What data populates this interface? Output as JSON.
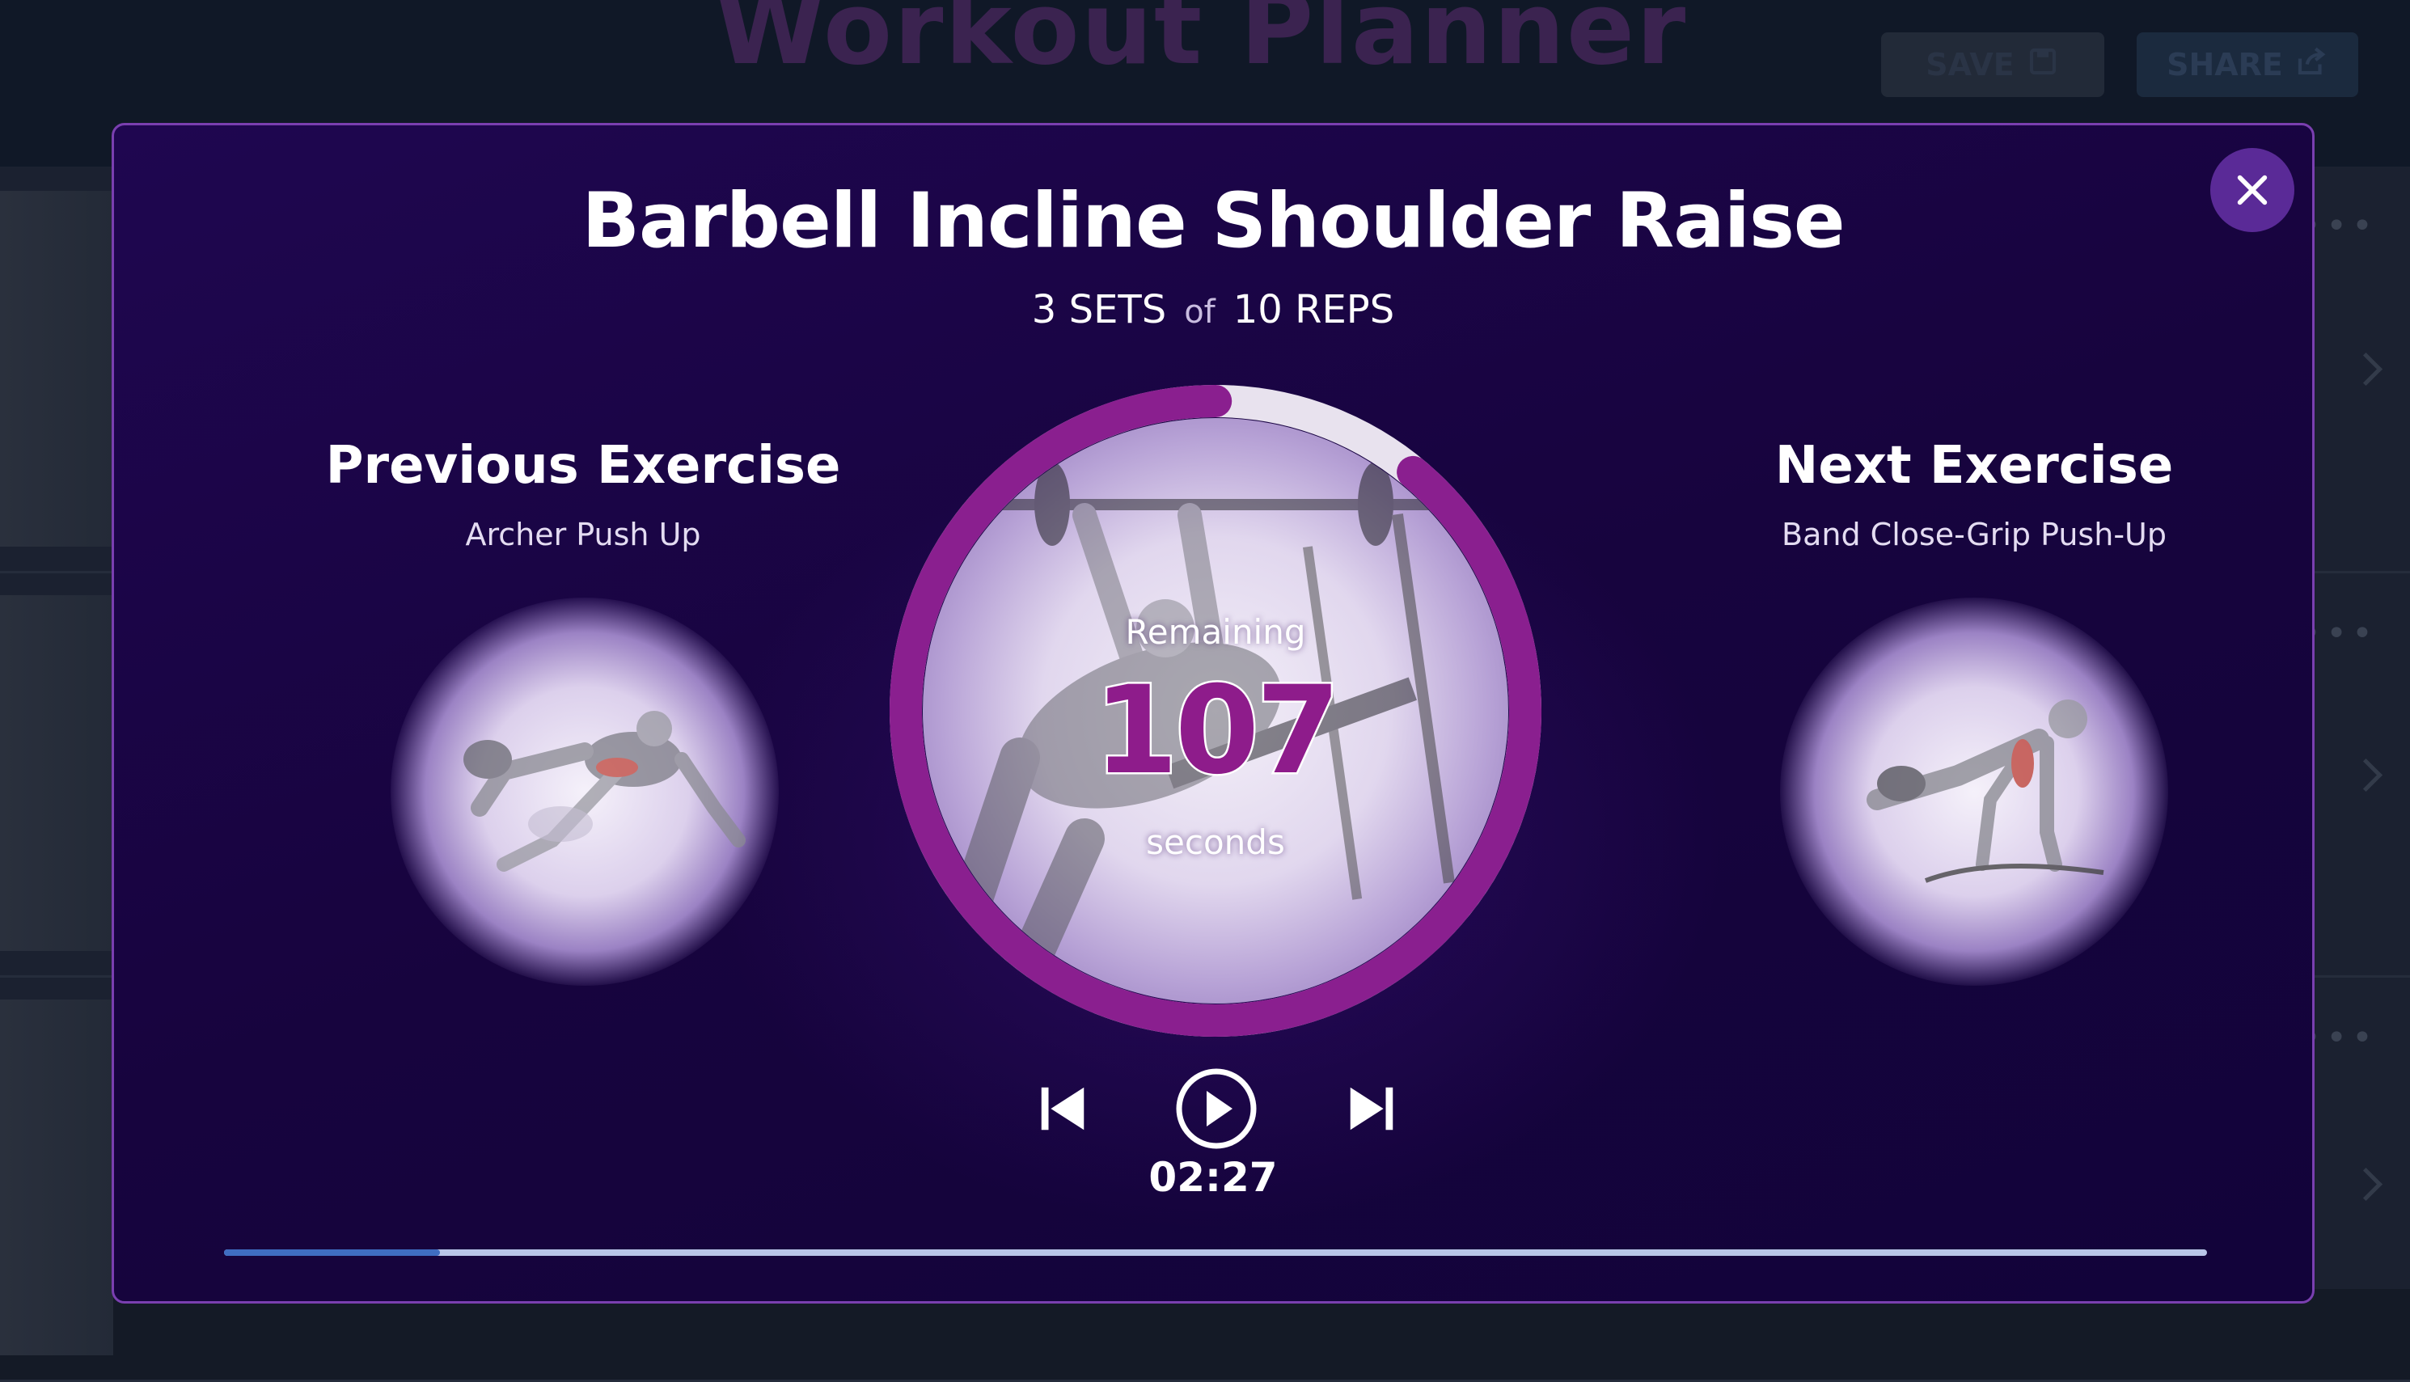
{
  "app": {
    "title": "Workout Planner",
    "save_label": "SAVE",
    "share_label": "SHARE"
  },
  "modal": {
    "exercise_title": "Barbell Incline Shoulder Raise",
    "sets_value": "3 SETS",
    "sets_joiner": "of",
    "reps_value": "10 REPS",
    "previous": {
      "label": "Previous Exercise",
      "name": "Archer Push Up"
    },
    "next": {
      "label": "Next Exercise",
      "name": "Band Close-Grip Push-Up"
    },
    "timer": {
      "label": "Remaining",
      "value": "107",
      "unit": "seconds",
      "remaining_fraction": 0.89
    },
    "elapsed_time": "02:27",
    "progress_fraction": 0.109
  },
  "colors": {
    "accent_purple": "#8e1c8b",
    "modal_bg": "#17043e",
    "close_bg": "#5a2a97",
    "progress_fill": "#3f6ec2",
    "progress_track": "#b9c6e8"
  },
  "icons": [
    "close-icon",
    "skip-previous-icon",
    "play-icon",
    "skip-next-icon",
    "save-icon",
    "share-icon"
  ]
}
